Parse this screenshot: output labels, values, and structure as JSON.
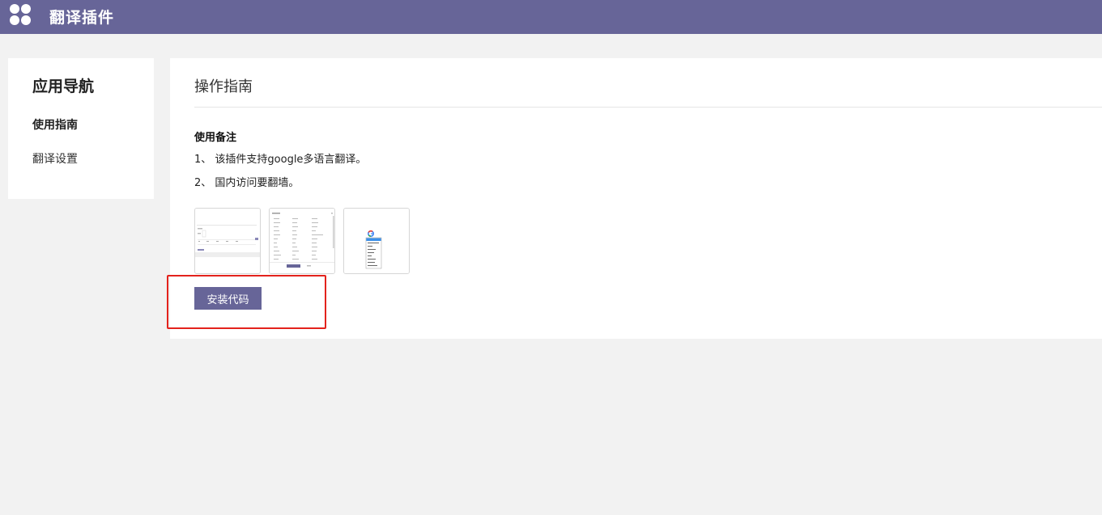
{
  "header": {
    "app_title": "翻译插件",
    "logo_icon": "clover-icon",
    "bar_color": "#676598"
  },
  "sidebar": {
    "title": "应用导航",
    "items": [
      {
        "label": "使用指南",
        "active": true
      },
      {
        "label": "翻译设置",
        "active": false
      }
    ]
  },
  "main": {
    "title": "操作指南",
    "section_title": "使用备注",
    "notes": [
      "1、 该插件支持google多语言翻译。",
      "2、 国内访问要翻墙。"
    ],
    "install_button": "安装代码",
    "accent_color": "#676598",
    "highlight_color": "#e3221c"
  }
}
